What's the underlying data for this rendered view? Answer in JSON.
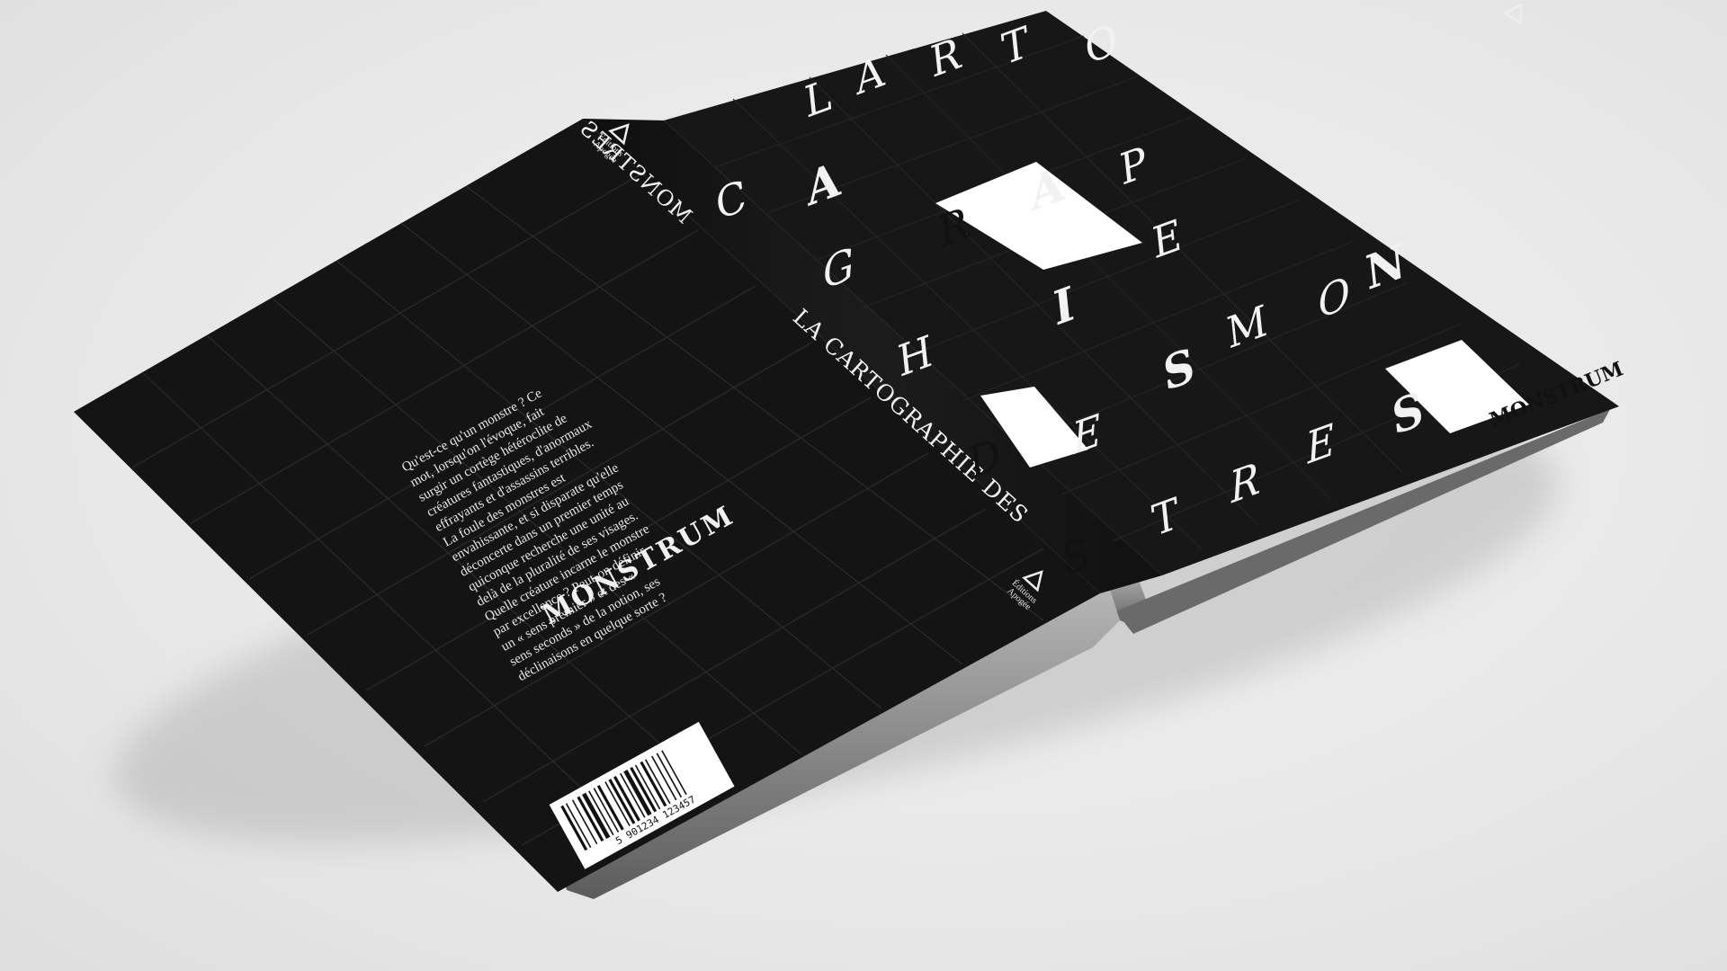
{
  "publisher": {
    "logo_icon": "triangle-logo-icon",
    "name_line1": "Éditions",
    "name_line2": "Apogée"
  },
  "title_letters": [
    {
      "char": "L",
      "style": "blackletter"
    },
    {
      "char": "A",
      "style": "stencil"
    },
    {
      "char": "R",
      "style": "roman"
    },
    {
      "char": "T",
      "style": "roman"
    },
    {
      "char": "O",
      "style": "roman"
    },
    {
      "char": "C",
      "style": "roman"
    },
    {
      "char": "A",
      "style": "bold"
    },
    {
      "char": "R",
      "style": "inverse-block"
    },
    {
      "char": "A",
      "style": "bold"
    },
    {
      "char": "P",
      "style": "roman"
    },
    {
      "char": "G",
      "style": "ornament"
    },
    {
      "char": "H",
      "style": "roman"
    },
    {
      "char": "I",
      "style": "bold"
    },
    {
      "char": "E",
      "style": "roman"
    },
    {
      "char": "D",
      "style": "inverse-block"
    },
    {
      "char": "E",
      "style": "ornament"
    },
    {
      "char": "S",
      "style": "bold"
    },
    {
      "char": "M",
      "style": "roman"
    },
    {
      "char": "O",
      "style": "ornament"
    },
    {
      "char": "N",
      "style": "bold"
    },
    {
      "char": "S",
      "style": "inverse-block"
    },
    {
      "char": "T",
      "style": "roman"
    },
    {
      "char": "R",
      "style": "ornament"
    },
    {
      "char": "E",
      "style": "ornament"
    },
    {
      "char": "S",
      "style": "bold"
    }
  ],
  "spine_title_line1": "LA CARTOGRAPHIE DES",
  "spine_title_line2": "MONSTRES",
  "series": "MONSTRUM",
  "back_cover": {
    "blurb": [
      "Qu'est-ce qu'un monstre ? Ce",
      "mot, lorsqu'on l'évoque, fait",
      "surgir un cortège hétéroclite de",
      "créatures fantastiques, d'anormaux",
      "effrayants et d'assassins terribles.",
      "La foule des monstres est",
      "envahissante, et si disparate qu'elle",
      "déconcerte dans un premier temps",
      "quiconque recherche une unité au",
      "delà de la pluralité de ses visages.",
      "Quelle créature incarne le monstre",
      "par excellence ? Peut-on définir",
      "un « sens premier » et des «",
      "sens seconds » de la notion, ses",
      "déclinaisons en quelque sorte ?"
    ],
    "series_logo": "MONSTRUM",
    "barcode_number": "5 901234 123457"
  },
  "colors": {
    "cover": "#151515",
    "background": "#e9e9e9",
    "accent": "#ffffff"
  }
}
